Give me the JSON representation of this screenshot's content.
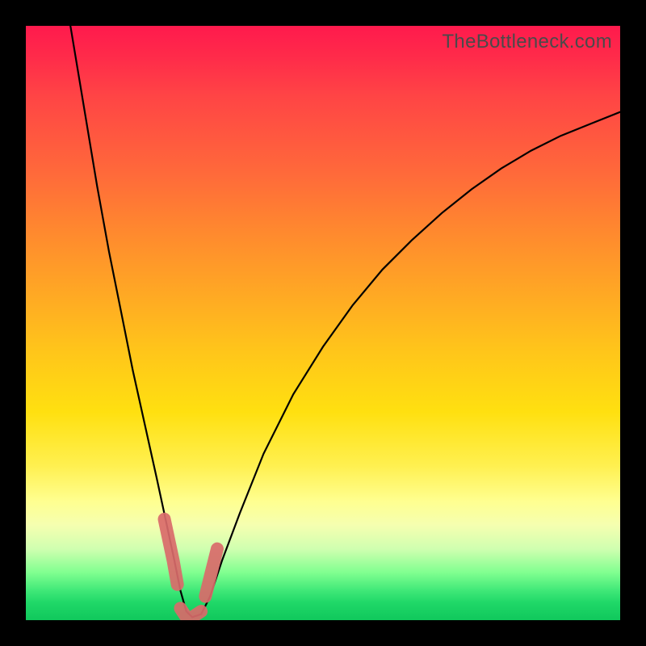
{
  "watermark": "TheBottleneck.com",
  "chart_data": {
    "type": "line",
    "title": "",
    "xlabel": "",
    "ylabel": "",
    "xlim": [
      0,
      100
    ],
    "ylim": [
      0,
      100
    ],
    "series": [
      {
        "name": "curve",
        "color": "#000000",
        "x": [
          7.5,
          10,
          12,
          14,
          16,
          18,
          20,
          22,
          23.5,
          25,
          26,
          27,
          28,
          29.5,
          31,
          33,
          36,
          40,
          45,
          50,
          55,
          60,
          65,
          70,
          75,
          80,
          85,
          90,
          95,
          100
        ],
        "y": [
          100,
          85,
          73,
          62,
          52,
          42,
          33,
          24,
          17,
          10,
          5,
          1.5,
          0.5,
          1,
          4,
          10,
          18,
          28,
          38,
          46,
          53,
          59,
          64,
          68.5,
          72.5,
          76,
          79,
          81.5,
          83.5,
          85.5
        ]
      },
      {
        "name": "highlight-left",
        "color": "#d96a6a",
        "x": [
          23.3,
          24.8,
          25.5
        ],
        "y": [
          17,
          10,
          6
        ]
      },
      {
        "name": "highlight-bottom",
        "color": "#d96a6a",
        "x": [
          26,
          27,
          28,
          29.5
        ],
        "y": [
          2,
          0.5,
          0.5,
          1.5
        ]
      },
      {
        "name": "highlight-right",
        "color": "#d96a6a",
        "x": [
          30.2,
          31.2,
          32.2
        ],
        "y": [
          4,
          8,
          12
        ]
      }
    ]
  }
}
